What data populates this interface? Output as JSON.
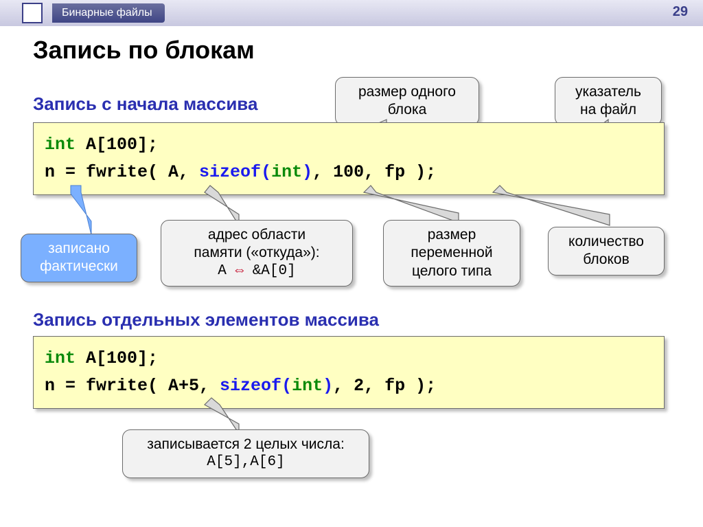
{
  "header": {
    "breadcrumb": "Бинарные файлы",
    "page_number": "29"
  },
  "title": "Запись по блокам",
  "section1": {
    "heading": "Запись с начала массива",
    "code": {
      "line1_kw": "int",
      "line1_rest": " A[100];",
      "line2_pre": "n = fwrite( A, ",
      "line2_sizeof": "sizeof",
      "line2_paren_open": "(",
      "line2_int": "int",
      "line2_paren_close": ")",
      "line2_post": ", 100, fp );"
    },
    "callouts": {
      "size_block": "размер одного блока",
      "file_ptr": "указатель на файл",
      "written": "записано фактически",
      "addr_l1": "адрес области",
      "addr_l2": "памяти («откуда»):",
      "addr_code1": "A",
      "addr_arrow": " ⇔ ",
      "addr_code2": "&A[0]",
      "varsize": "размер переменной целого типа",
      "nblocks": "количество блоков"
    }
  },
  "section2": {
    "heading": "Запись отдельных элементов массива",
    "code": {
      "line1_kw": "int",
      "line1_rest": " A[100];",
      "line2_pre": "n = fwrite( A+5, ",
      "line2_sizeof": "sizeof",
      "line2_paren_open": "(",
      "line2_int": "int",
      "line2_paren_close": ")",
      "line2_post": ", 2, fp );"
    },
    "callouts": {
      "two_ints_l1": "записывается 2 целых числа:",
      "two_ints_code": "A[5],A[6]"
    }
  }
}
